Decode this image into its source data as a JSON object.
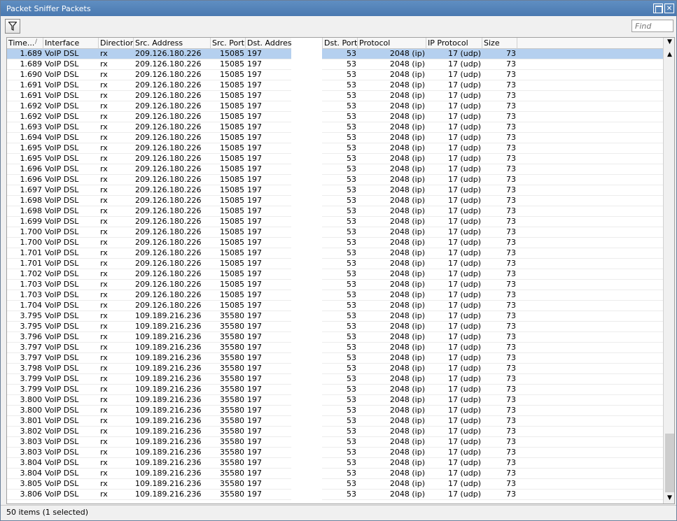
{
  "window": {
    "title": "Packet Sniffer Packets",
    "maximize": "",
    "close": "✕"
  },
  "toolbar": {
    "find_placeholder": "Find"
  },
  "columns": [
    "Time...",
    "Interface",
    "Direction",
    "Src. Address",
    "Src. Port",
    "Dst. Address",
    "Dst. Port",
    "Protocol",
    "IP Protocol",
    "Size"
  ],
  "sort_indicator": "/",
  "rows": [
    [
      "1.689",
      "VoIP DSL",
      "rx",
      "209.126.180.226",
      "15085",
      "197",
      "53",
      "2048 (ip)",
      "17 (udp)",
      "73"
    ],
    [
      "1.689",
      "VoIP DSL",
      "rx",
      "209.126.180.226",
      "15085",
      "197",
      "53",
      "2048 (ip)",
      "17 (udp)",
      "73"
    ],
    [
      "1.690",
      "VoIP DSL",
      "rx",
      "209.126.180.226",
      "15085",
      "197",
      "53",
      "2048 (ip)",
      "17 (udp)",
      "73"
    ],
    [
      "1.691",
      "VoIP DSL",
      "rx",
      "209.126.180.226",
      "15085",
      "197",
      "53",
      "2048 (ip)",
      "17 (udp)",
      "73"
    ],
    [
      "1.691",
      "VoIP DSL",
      "rx",
      "209.126.180.226",
      "15085",
      "197",
      "53",
      "2048 (ip)",
      "17 (udp)",
      "73"
    ],
    [
      "1.692",
      "VoIP DSL",
      "rx",
      "209.126.180.226",
      "15085",
      "197",
      "53",
      "2048 (ip)",
      "17 (udp)",
      "73"
    ],
    [
      "1.692",
      "VoIP DSL",
      "rx",
      "209.126.180.226",
      "15085",
      "197",
      "53",
      "2048 (ip)",
      "17 (udp)",
      "73"
    ],
    [
      "1.693",
      "VoIP DSL",
      "rx",
      "209.126.180.226",
      "15085",
      "197",
      "53",
      "2048 (ip)",
      "17 (udp)",
      "73"
    ],
    [
      "1.694",
      "VoIP DSL",
      "rx",
      "209.126.180.226",
      "15085",
      "197",
      "53",
      "2048 (ip)",
      "17 (udp)",
      "73"
    ],
    [
      "1.695",
      "VoIP DSL",
      "rx",
      "209.126.180.226",
      "15085",
      "197",
      "53",
      "2048 (ip)",
      "17 (udp)",
      "73"
    ],
    [
      "1.695",
      "VoIP DSL",
      "rx",
      "209.126.180.226",
      "15085",
      "197",
      "53",
      "2048 (ip)",
      "17 (udp)",
      "73"
    ],
    [
      "1.696",
      "VoIP DSL",
      "rx",
      "209.126.180.226",
      "15085",
      "197",
      "53",
      "2048 (ip)",
      "17 (udp)",
      "73"
    ],
    [
      "1.696",
      "VoIP DSL",
      "rx",
      "209.126.180.226",
      "15085",
      "197",
      "53",
      "2048 (ip)",
      "17 (udp)",
      "73"
    ],
    [
      "1.697",
      "VoIP DSL",
      "rx",
      "209.126.180.226",
      "15085",
      "197",
      "53",
      "2048 (ip)",
      "17 (udp)",
      "73"
    ],
    [
      "1.698",
      "VoIP DSL",
      "rx",
      "209.126.180.226",
      "15085",
      "197",
      "53",
      "2048 (ip)",
      "17 (udp)",
      "73"
    ],
    [
      "1.698",
      "VoIP DSL",
      "rx",
      "209.126.180.226",
      "15085",
      "197",
      "53",
      "2048 (ip)",
      "17 (udp)",
      "73"
    ],
    [
      "1.699",
      "VoIP DSL",
      "rx",
      "209.126.180.226",
      "15085",
      "197",
      "53",
      "2048 (ip)",
      "17 (udp)",
      "73"
    ],
    [
      "1.700",
      "VoIP DSL",
      "rx",
      "209.126.180.226",
      "15085",
      "197",
      "53",
      "2048 (ip)",
      "17 (udp)",
      "73"
    ],
    [
      "1.700",
      "VoIP DSL",
      "rx",
      "209.126.180.226",
      "15085",
      "197",
      "53",
      "2048 (ip)",
      "17 (udp)",
      "73"
    ],
    [
      "1.701",
      "VoIP DSL",
      "rx",
      "209.126.180.226",
      "15085",
      "197",
      "53",
      "2048 (ip)",
      "17 (udp)",
      "73"
    ],
    [
      "1.701",
      "VoIP DSL",
      "rx",
      "209.126.180.226",
      "15085",
      "197",
      "53",
      "2048 (ip)",
      "17 (udp)",
      "73"
    ],
    [
      "1.702",
      "VoIP DSL",
      "rx",
      "209.126.180.226",
      "15085",
      "197",
      "53",
      "2048 (ip)",
      "17 (udp)",
      "73"
    ],
    [
      "1.703",
      "VoIP DSL",
      "rx",
      "209.126.180.226",
      "15085",
      "197",
      "53",
      "2048 (ip)",
      "17 (udp)",
      "73"
    ],
    [
      "1.703",
      "VoIP DSL",
      "rx",
      "209.126.180.226",
      "15085",
      "197",
      "53",
      "2048 (ip)",
      "17 (udp)",
      "73"
    ],
    [
      "1.704",
      "VoIP DSL",
      "rx",
      "209.126.180.226",
      "15085",
      "197",
      "53",
      "2048 (ip)",
      "17 (udp)",
      "73"
    ],
    [
      "3.795",
      "VoIP DSL",
      "rx",
      "109.189.216.236",
      "35580",
      "197",
      "53",
      "2048 (ip)",
      "17 (udp)",
      "73"
    ],
    [
      "3.795",
      "VoIP DSL",
      "rx",
      "109.189.216.236",
      "35580",
      "197",
      "53",
      "2048 (ip)",
      "17 (udp)",
      "73"
    ],
    [
      "3.796",
      "VoIP DSL",
      "rx",
      "109.189.216.236",
      "35580",
      "197",
      "53",
      "2048 (ip)",
      "17 (udp)",
      "73"
    ],
    [
      "3.797",
      "VoIP DSL",
      "rx",
      "109.189.216.236",
      "35580",
      "197",
      "53",
      "2048 (ip)",
      "17 (udp)",
      "73"
    ],
    [
      "3.797",
      "VoIP DSL",
      "rx",
      "109.189.216.236",
      "35580",
      "197",
      "53",
      "2048 (ip)",
      "17 (udp)",
      "73"
    ],
    [
      "3.798",
      "VoIP DSL",
      "rx",
      "109.189.216.236",
      "35580",
      "197",
      "53",
      "2048 (ip)",
      "17 (udp)",
      "73"
    ],
    [
      "3.799",
      "VoIP DSL",
      "rx",
      "109.189.216.236",
      "35580",
      "197",
      "53",
      "2048 (ip)",
      "17 (udp)",
      "73"
    ],
    [
      "3.799",
      "VoIP DSL",
      "rx",
      "109.189.216.236",
      "35580",
      "197",
      "53",
      "2048 (ip)",
      "17 (udp)",
      "73"
    ],
    [
      "3.800",
      "VoIP DSL",
      "rx",
      "109.189.216.236",
      "35580",
      "197",
      "53",
      "2048 (ip)",
      "17 (udp)",
      "73"
    ],
    [
      "3.800",
      "VoIP DSL",
      "rx",
      "109.189.216.236",
      "35580",
      "197",
      "53",
      "2048 (ip)",
      "17 (udp)",
      "73"
    ],
    [
      "3.801",
      "VoIP DSL",
      "rx",
      "109.189.216.236",
      "35580",
      "197",
      "53",
      "2048 (ip)",
      "17 (udp)",
      "73"
    ],
    [
      "3.802",
      "VoIP DSL",
      "rx",
      "109.189.216.236",
      "35580",
      "197",
      "53",
      "2048 (ip)",
      "17 (udp)",
      "73"
    ],
    [
      "3.803",
      "VoIP DSL",
      "rx",
      "109.189.216.236",
      "35580",
      "197",
      "53",
      "2048 (ip)",
      "17 (udp)",
      "73"
    ],
    [
      "3.803",
      "VoIP DSL",
      "rx",
      "109.189.216.236",
      "35580",
      "197",
      "53",
      "2048 (ip)",
      "17 (udp)",
      "73"
    ],
    [
      "3.804",
      "VoIP DSL",
      "rx",
      "109.189.216.236",
      "35580",
      "197",
      "53",
      "2048 (ip)",
      "17 (udp)",
      "73"
    ],
    [
      "3.804",
      "VoIP DSL",
      "rx",
      "109.189.216.236",
      "35580",
      "197",
      "53",
      "2048 (ip)",
      "17 (udp)",
      "73"
    ],
    [
      "3.805",
      "VoIP DSL",
      "rx",
      "109.189.216.236",
      "35580",
      "197",
      "53",
      "2048 (ip)",
      "17 (udp)",
      "73"
    ],
    [
      "3.806",
      "VoIP DSL",
      "rx",
      "109.189.216.236",
      "35580",
      "197",
      "53",
      "2048 (ip)",
      "17 (udp)",
      "73"
    ]
  ],
  "selected_row": 0,
  "status": "50 items (1 selected)",
  "colors": {
    "selection": "#b5d0ef",
    "titlebar": "#5b8ac0"
  }
}
